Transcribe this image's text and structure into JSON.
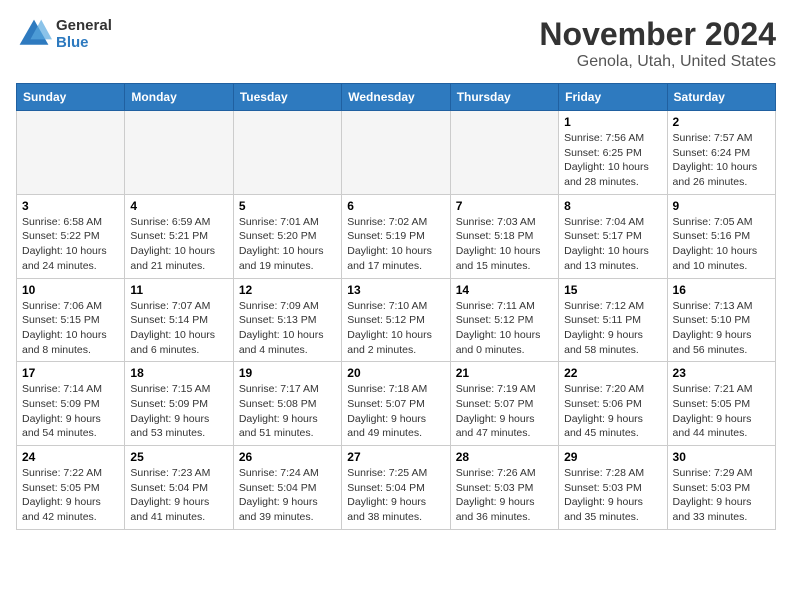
{
  "logo": {
    "line1": "General",
    "line2": "Blue"
  },
  "title": "November 2024",
  "location": "Genola, Utah, United States",
  "weekdays": [
    "Sunday",
    "Monday",
    "Tuesday",
    "Wednesday",
    "Thursday",
    "Friday",
    "Saturday"
  ],
  "weeks": [
    [
      {
        "day": "",
        "info": ""
      },
      {
        "day": "",
        "info": ""
      },
      {
        "day": "",
        "info": ""
      },
      {
        "day": "",
        "info": ""
      },
      {
        "day": "",
        "info": ""
      },
      {
        "day": "1",
        "info": "Sunrise: 7:56 AM\nSunset: 6:25 PM\nDaylight: 10 hours and 28 minutes."
      },
      {
        "day": "2",
        "info": "Sunrise: 7:57 AM\nSunset: 6:24 PM\nDaylight: 10 hours and 26 minutes."
      }
    ],
    [
      {
        "day": "3",
        "info": "Sunrise: 6:58 AM\nSunset: 5:22 PM\nDaylight: 10 hours and 24 minutes."
      },
      {
        "day": "4",
        "info": "Sunrise: 6:59 AM\nSunset: 5:21 PM\nDaylight: 10 hours and 21 minutes."
      },
      {
        "day": "5",
        "info": "Sunrise: 7:01 AM\nSunset: 5:20 PM\nDaylight: 10 hours and 19 minutes."
      },
      {
        "day": "6",
        "info": "Sunrise: 7:02 AM\nSunset: 5:19 PM\nDaylight: 10 hours and 17 minutes."
      },
      {
        "day": "7",
        "info": "Sunrise: 7:03 AM\nSunset: 5:18 PM\nDaylight: 10 hours and 15 minutes."
      },
      {
        "day": "8",
        "info": "Sunrise: 7:04 AM\nSunset: 5:17 PM\nDaylight: 10 hours and 13 minutes."
      },
      {
        "day": "9",
        "info": "Sunrise: 7:05 AM\nSunset: 5:16 PM\nDaylight: 10 hours and 10 minutes."
      }
    ],
    [
      {
        "day": "10",
        "info": "Sunrise: 7:06 AM\nSunset: 5:15 PM\nDaylight: 10 hours and 8 minutes."
      },
      {
        "day": "11",
        "info": "Sunrise: 7:07 AM\nSunset: 5:14 PM\nDaylight: 10 hours and 6 minutes."
      },
      {
        "day": "12",
        "info": "Sunrise: 7:09 AM\nSunset: 5:13 PM\nDaylight: 10 hours and 4 minutes."
      },
      {
        "day": "13",
        "info": "Sunrise: 7:10 AM\nSunset: 5:12 PM\nDaylight: 10 hours and 2 minutes."
      },
      {
        "day": "14",
        "info": "Sunrise: 7:11 AM\nSunset: 5:12 PM\nDaylight: 10 hours and 0 minutes."
      },
      {
        "day": "15",
        "info": "Sunrise: 7:12 AM\nSunset: 5:11 PM\nDaylight: 9 hours and 58 minutes."
      },
      {
        "day": "16",
        "info": "Sunrise: 7:13 AM\nSunset: 5:10 PM\nDaylight: 9 hours and 56 minutes."
      }
    ],
    [
      {
        "day": "17",
        "info": "Sunrise: 7:14 AM\nSunset: 5:09 PM\nDaylight: 9 hours and 54 minutes."
      },
      {
        "day": "18",
        "info": "Sunrise: 7:15 AM\nSunset: 5:09 PM\nDaylight: 9 hours and 53 minutes."
      },
      {
        "day": "19",
        "info": "Sunrise: 7:17 AM\nSunset: 5:08 PM\nDaylight: 9 hours and 51 minutes."
      },
      {
        "day": "20",
        "info": "Sunrise: 7:18 AM\nSunset: 5:07 PM\nDaylight: 9 hours and 49 minutes."
      },
      {
        "day": "21",
        "info": "Sunrise: 7:19 AM\nSunset: 5:07 PM\nDaylight: 9 hours and 47 minutes."
      },
      {
        "day": "22",
        "info": "Sunrise: 7:20 AM\nSunset: 5:06 PM\nDaylight: 9 hours and 45 minutes."
      },
      {
        "day": "23",
        "info": "Sunrise: 7:21 AM\nSunset: 5:05 PM\nDaylight: 9 hours and 44 minutes."
      }
    ],
    [
      {
        "day": "24",
        "info": "Sunrise: 7:22 AM\nSunset: 5:05 PM\nDaylight: 9 hours and 42 minutes."
      },
      {
        "day": "25",
        "info": "Sunrise: 7:23 AM\nSunset: 5:04 PM\nDaylight: 9 hours and 41 minutes."
      },
      {
        "day": "26",
        "info": "Sunrise: 7:24 AM\nSunset: 5:04 PM\nDaylight: 9 hours and 39 minutes."
      },
      {
        "day": "27",
        "info": "Sunrise: 7:25 AM\nSunset: 5:04 PM\nDaylight: 9 hours and 38 minutes."
      },
      {
        "day": "28",
        "info": "Sunrise: 7:26 AM\nSunset: 5:03 PM\nDaylight: 9 hours and 36 minutes."
      },
      {
        "day": "29",
        "info": "Sunrise: 7:28 AM\nSunset: 5:03 PM\nDaylight: 9 hours and 35 minutes."
      },
      {
        "day": "30",
        "info": "Sunrise: 7:29 AM\nSunset: 5:03 PM\nDaylight: 9 hours and 33 minutes."
      }
    ]
  ]
}
